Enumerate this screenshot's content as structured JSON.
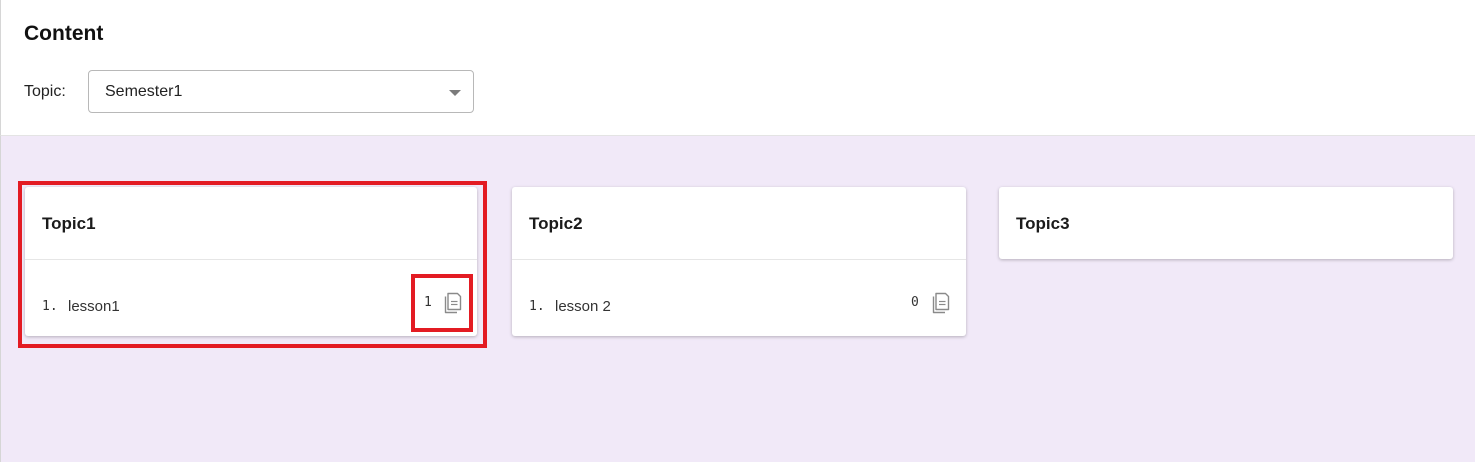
{
  "page": {
    "title": "Content"
  },
  "filter": {
    "label": "Topic:",
    "selected": "Semester1"
  },
  "topics": [
    {
      "title": "Topic1",
      "lessons": [
        {
          "num": "1.",
          "name": "lesson1",
          "count": "1"
        }
      ]
    },
    {
      "title": "Topic2",
      "lessons": [
        {
          "num": "1.",
          "name": "lesson 2",
          "count": "0"
        }
      ]
    },
    {
      "title": "Topic3",
      "lessons": []
    }
  ],
  "colors": {
    "content_bg": "#f1e9f8",
    "highlight": "#e31b23",
    "icon": "#8a8a8a"
  },
  "icons": {
    "lesson_count": "document-copy-icon",
    "select_caret": "caret-down-icon"
  }
}
